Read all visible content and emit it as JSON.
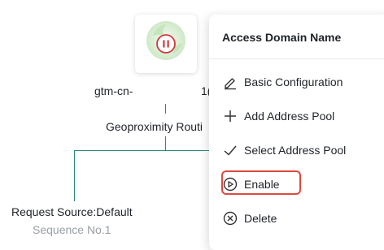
{
  "topology": {
    "instance_id_prefix": "gtm-cn-",
    "instance_id_suffix": "1(",
    "policy_label": "Geoproximity Routi",
    "pool_label": "Request Source:Default",
    "sequence_label": "Sequence No.1",
    "node_icon": "pause-circle-icon",
    "line_color": "#2b8c7c"
  },
  "menu": {
    "title": "Access Domain Name",
    "items": [
      {
        "label": "Basic Configuration",
        "icon": "edit-icon"
      },
      {
        "label": "Add Address Pool",
        "icon": "plus-icon"
      },
      {
        "label": "Select Address Pool",
        "icon": "check-icon"
      },
      {
        "label": "Enable",
        "icon": "play-circle-icon",
        "highlighted": true
      },
      {
        "label": "Delete",
        "icon": "close-circle-icon"
      }
    ],
    "highlight_color": "#e0483e"
  }
}
